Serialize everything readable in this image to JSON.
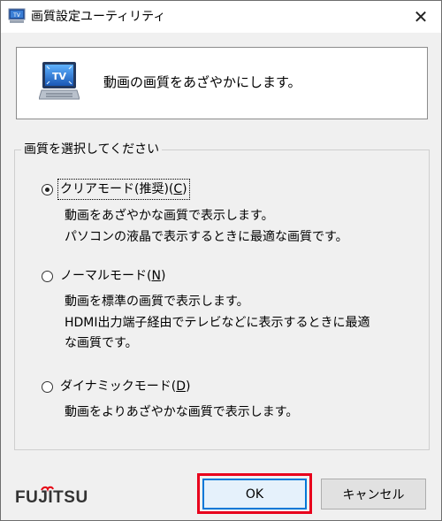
{
  "window": {
    "title": "画質設定ユーティリティ",
    "close_symbol": "✕"
  },
  "header": {
    "icon": "tv-monitor-icon",
    "icon_text": "TV",
    "message": "動画の画質をあざやかにします。"
  },
  "group": {
    "legend": "画質を選択してください",
    "options": [
      {
        "label": "クリアモード(推奨)(",
        "accel": "C",
        "suffix": ")",
        "checked": true,
        "desc": [
          "動画をあざやかな画質で表示します。",
          "パソコンの液晶で表示するときに最適な画質です。"
        ]
      },
      {
        "label": "ノーマルモード(",
        "accel": "N",
        "suffix": ")",
        "checked": false,
        "desc": [
          "動画を標準の画質で表示します。",
          "HDMI出力端子経由でテレビなどに表示するときに最適",
          "な画質です。"
        ]
      },
      {
        "label": "ダイナミックモード(",
        "accel": "D",
        "suffix": ")",
        "checked": false,
        "desc": [
          "動画をよりあざやかな画質で表示します。"
        ]
      }
    ]
  },
  "footer": {
    "brand": "FUJITSU",
    "ok_label": "OK",
    "cancel_label": "キャンセル"
  },
  "colors": {
    "highlight": "#e8001c",
    "focus": "#0078d7",
    "brand_red": "#e60012"
  }
}
